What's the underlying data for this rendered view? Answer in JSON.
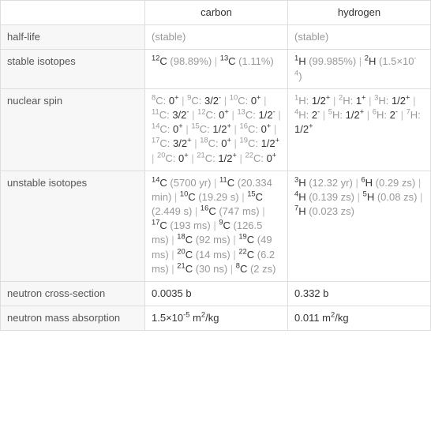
{
  "headers": {
    "blank": "",
    "carbon": "carbon",
    "hydrogen": "hydrogen"
  },
  "rows": {
    "half_life": {
      "label": "half-life",
      "carbon": "(stable)",
      "hydrogen": "(stable)"
    },
    "stable_isotopes": {
      "label": "stable isotopes",
      "carbon": {
        "items": [
          {
            "sup": "12",
            "sym": "C",
            "note": "(98.89%)"
          },
          {
            "sup": "13",
            "sym": "C",
            "note": "(1.11%)"
          }
        ]
      },
      "hydrogen": {
        "items": [
          {
            "sup": "1",
            "sym": "H",
            "note": "(99.985%)"
          },
          {
            "sup": "2",
            "sym": "H",
            "note": "(1.5×10",
            "note_sup": "-4",
            "note_tail": ")"
          }
        ]
      }
    },
    "nuclear_spin": {
      "label": "nuclear spin",
      "carbon": {
        "items": [
          {
            "iso_sup": "8",
            "iso": "C",
            "spin": "0",
            "spin_sup": "+"
          },
          {
            "iso_sup": "9",
            "iso": "C",
            "spin": "3/2",
            "spin_sup": "-"
          },
          {
            "iso_sup": "10",
            "iso": "C",
            "spin": "0",
            "spin_sup": "+"
          },
          {
            "iso_sup": "11",
            "iso": "C",
            "spin": "3/2",
            "spin_sup": "-"
          },
          {
            "iso_sup": "12",
            "iso": "C",
            "spin": "0",
            "spin_sup": "+"
          },
          {
            "iso_sup": "13",
            "iso": "C",
            "spin": "1/2",
            "spin_sup": "-"
          },
          {
            "iso_sup": "14",
            "iso": "C",
            "spin": "0",
            "spin_sup": "+"
          },
          {
            "iso_sup": "15",
            "iso": "C",
            "spin": "1/2",
            "spin_sup": "+"
          },
          {
            "iso_sup": "16",
            "iso": "C",
            "spin": "0",
            "spin_sup": "+"
          },
          {
            "iso_sup": "17",
            "iso": "C",
            "spin": "3/2",
            "spin_sup": "+"
          },
          {
            "iso_sup": "18",
            "iso": "C",
            "spin": "0",
            "spin_sup": "+"
          },
          {
            "iso_sup": "19",
            "iso": "C",
            "spin": "1/2",
            "spin_sup": "+"
          },
          {
            "iso_sup": "20",
            "iso": "C",
            "spin": "0",
            "spin_sup": "+"
          },
          {
            "iso_sup": "21",
            "iso": "C",
            "spin": "1/2",
            "spin_sup": "+"
          },
          {
            "iso_sup": "22",
            "iso": "C",
            "spin": "0",
            "spin_sup": "+"
          }
        ]
      },
      "hydrogen": {
        "items": [
          {
            "iso_sup": "1",
            "iso": "H",
            "spin": "1/2",
            "spin_sup": "+"
          },
          {
            "iso_sup": "2",
            "iso": "H",
            "spin": "1",
            "spin_sup": "+"
          },
          {
            "iso_sup": "3",
            "iso": "H",
            "spin": "1/2",
            "spin_sup": "+"
          },
          {
            "iso_sup": "4",
            "iso": "H",
            "spin": "2",
            "spin_sup": "-"
          },
          {
            "iso_sup": "5",
            "iso": "H",
            "spin": "1/2",
            "spin_sup": "+"
          },
          {
            "iso_sup": "6",
            "iso": "H",
            "spin": "2",
            "spin_sup": "-"
          },
          {
            "iso_sup": "7",
            "iso": "H",
            "spin": "1/2",
            "spin_sup": "+"
          }
        ]
      }
    },
    "unstable_isotopes": {
      "label": "unstable isotopes",
      "carbon": {
        "items": [
          {
            "sup": "14",
            "sym": "C",
            "note": "(5700 yr)"
          },
          {
            "sup": "11",
            "sym": "C",
            "note": "(20.334 min)"
          },
          {
            "sup": "10",
            "sym": "C",
            "note": "(19.29 s)"
          },
          {
            "sup": "15",
            "sym": "C",
            "note": "(2.449 s)"
          },
          {
            "sup": "16",
            "sym": "C",
            "note": "(747 ms)"
          },
          {
            "sup": "17",
            "sym": "C",
            "note": "(193 ms)"
          },
          {
            "sup": "9",
            "sym": "C",
            "note": "(126.5 ms)"
          },
          {
            "sup": "18",
            "sym": "C",
            "note": "(92 ms)"
          },
          {
            "sup": "19",
            "sym": "C",
            "note": "(49 ms)"
          },
          {
            "sup": "20",
            "sym": "C",
            "note": "(14 ms)"
          },
          {
            "sup": "22",
            "sym": "C",
            "note": "(6.2 ms)"
          },
          {
            "sup": "21",
            "sym": "C",
            "note": "(30 ns)"
          },
          {
            "sup": "8",
            "sym": "C",
            "note": "(2 zs)"
          }
        ]
      },
      "hydrogen": {
        "items": [
          {
            "sup": "3",
            "sym": "H",
            "note": "(12.32 yr)"
          },
          {
            "sup": "6",
            "sym": "H",
            "note": "(0.29 zs)"
          },
          {
            "sup": "4",
            "sym": "H",
            "note": "(0.139 zs)"
          },
          {
            "sup": "5",
            "sym": "H",
            "note": "(0.08 zs)"
          },
          {
            "sup": "7",
            "sym": "H",
            "note": "(0.023 zs)"
          }
        ]
      }
    },
    "neutron_cs": {
      "label": "neutron cross-section",
      "carbon": "0.0035 b",
      "hydrogen": "0.332 b"
    },
    "neutron_mass_abs": {
      "label": "neutron mass absorption",
      "carbon": {
        "base": "1.5×10",
        "sup": "-5",
        "tail": " m",
        "unit_sup": "2",
        "tail2": "/kg"
      },
      "hydrogen": {
        "base": "0.011 m",
        "unit_sup": "2",
        "tail2": "/kg"
      }
    }
  },
  "sep": " | "
}
